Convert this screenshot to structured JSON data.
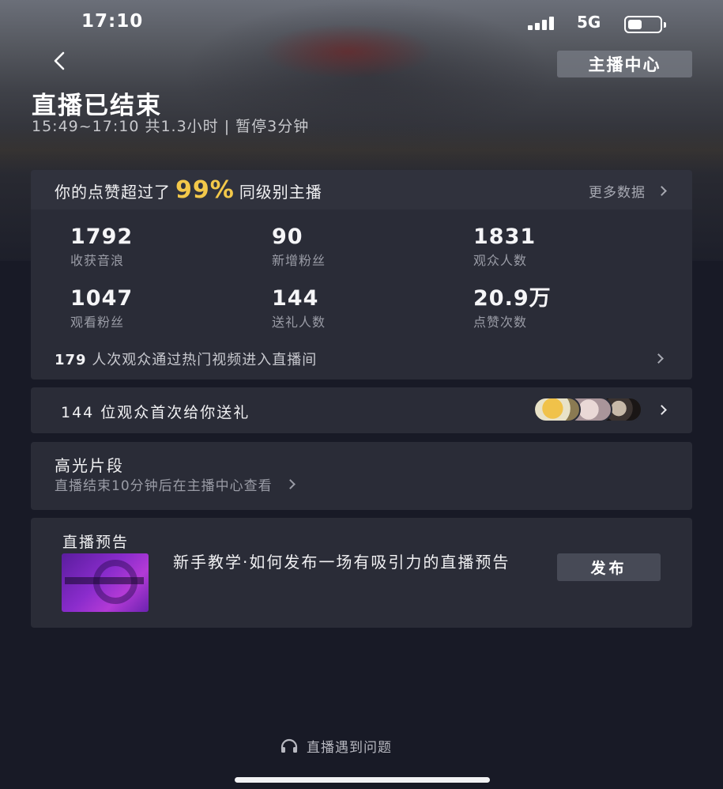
{
  "status_bar": {
    "time": "17:10",
    "network": "5G",
    "battery_level": 0.45
  },
  "header": {
    "back_icon": "chevron-left-icon",
    "center_button": "主播中心",
    "title": "直播已结束",
    "subtitle": "15:49~17:10  共1.3小时 | 暂停3分钟"
  },
  "summary": {
    "likes_prefix": "你的点赞超过了",
    "likes_percent": "99%",
    "likes_suffix": "同级别主播",
    "more_data": "更多数据",
    "stats": [
      {
        "value": "1792",
        "label": "收获音浪"
      },
      {
        "value": "90",
        "label": "新增粉丝"
      },
      {
        "value": "1831",
        "label": "观众人数"
      },
      {
        "value": "1047",
        "label": "观看粉丝"
      },
      {
        "value": "144",
        "label": "送礼人数"
      },
      {
        "value": "20.9万",
        "label": "点赞次数"
      }
    ],
    "hot_count": "179",
    "hot_text": "人次观众通过热门视频进入直播间"
  },
  "gift": {
    "text": "144 位观众首次给你送礼"
  },
  "highlights": {
    "title": "高光片段",
    "subtitle": "直播结束10分钟后在主播中心查看"
  },
  "preview": {
    "title": "直播预告",
    "description": "新手教学·如何发布一场有吸引力的直播预告",
    "publish_button": "发布"
  },
  "footer": {
    "help_text": "直播遇到问题",
    "help_icon": "headset-icon"
  },
  "colors": {
    "accent_gold": "#f3c84a",
    "card_bg": "#2a2c37",
    "page_bg": "#181a26"
  }
}
